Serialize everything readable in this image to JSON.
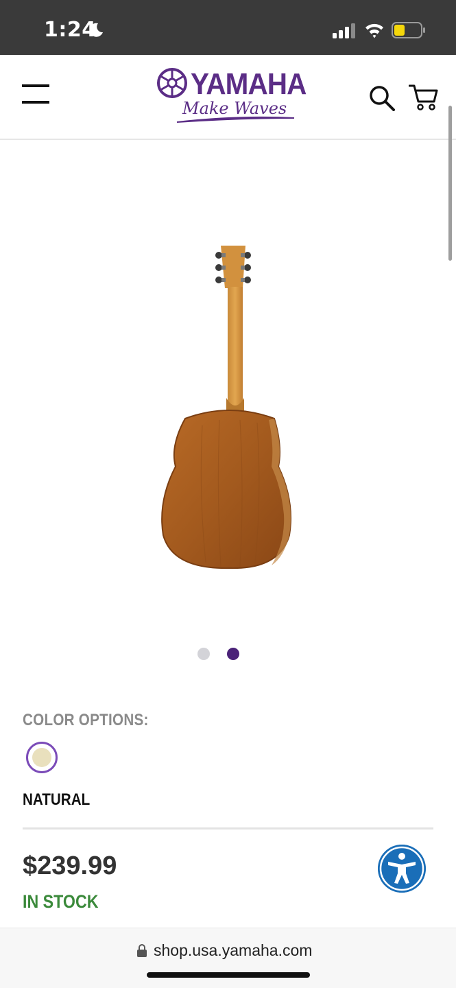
{
  "status_bar": {
    "time": "1:24",
    "icons": [
      "moon-icon",
      "cellular-signal-icon",
      "wifi-icon",
      "battery-icon"
    ]
  },
  "header": {
    "logo": {
      "brand": "YAMAHA",
      "tagline": "Make Waves"
    },
    "icons": [
      "menu-icon",
      "search-icon",
      "cart-icon"
    ]
  },
  "gallery": {
    "image": "guitar-back-image",
    "slide_count": 2,
    "active_slide": 2
  },
  "color_options": {
    "label": "COLOR OPTIONS:",
    "selected": "NATURAL",
    "swatch_color": "#e9e0bd"
  },
  "product": {
    "price": "$239.99",
    "stock_status": "IN STOCK"
  },
  "browser": {
    "url": "shop.usa.yamaha.com"
  },
  "colors": {
    "brand": "#5b2d86",
    "active_dot": "#4a2278",
    "in_stock": "#3b8a3b",
    "accessibility": "#1a6eb8"
  }
}
